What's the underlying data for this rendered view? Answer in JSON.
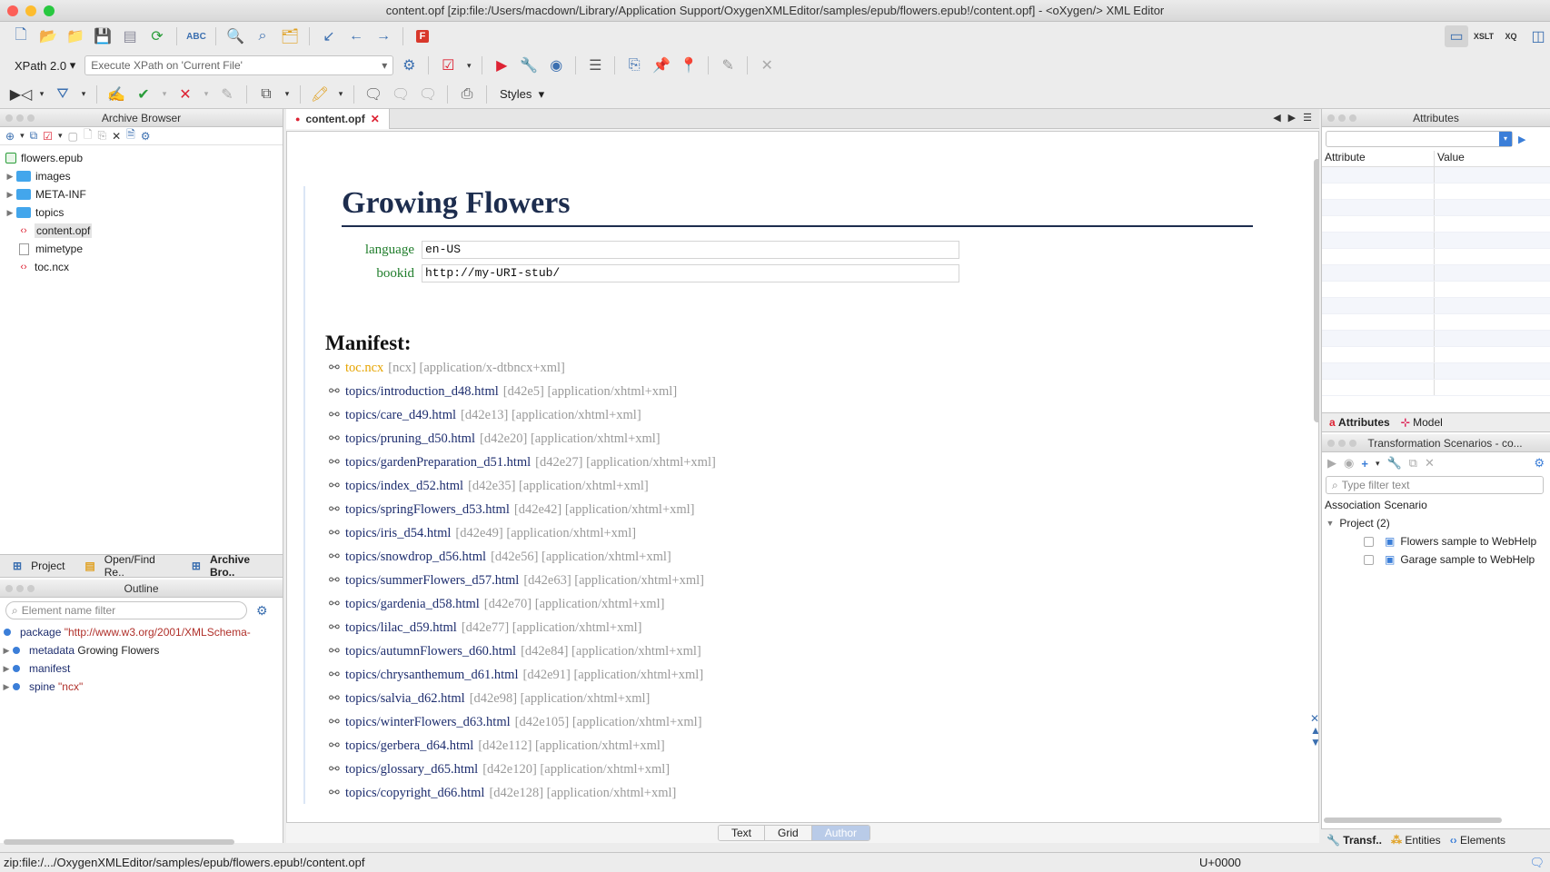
{
  "window": {
    "title": "content.opf [zip:file:/Users/macdown/Library/Application Support/OxygenXMLEditor/samples/epub/flowers.epub!/content.opf] - <oXygen/> XML Editor"
  },
  "xpath": {
    "version": "XPath 2.0",
    "placeholder": "Execute XPath on  'Current File'"
  },
  "toolbar": {
    "styles_label": "Styles"
  },
  "archive": {
    "title": "Archive Browser",
    "root": "flowers.epub",
    "items": [
      {
        "label": "images",
        "type": "folder"
      },
      {
        "label": "META-INF",
        "type": "folder"
      },
      {
        "label": "topics",
        "type": "folder"
      },
      {
        "label": "content.opf",
        "type": "xml"
      },
      {
        "label": "mimetype",
        "type": "file"
      },
      {
        "label": "toc.ncx",
        "type": "xml"
      }
    ]
  },
  "left_tabs": [
    "Project",
    "Open/Find Re..",
    "Archive Bro.."
  ],
  "outline": {
    "title": "Outline",
    "filter_placeholder": "Element name filter",
    "rows": [
      {
        "name": "package",
        "value": "\"http://www.w3.org/2001/XMLSchema-"
      },
      {
        "name": "metadata",
        "value": "Growing Flowers"
      },
      {
        "name": "manifest",
        "value": ""
      },
      {
        "name": "spine",
        "value": "\"ncx\""
      }
    ]
  },
  "editor": {
    "tab_label": "content.opf",
    "title": "Growing Flowers",
    "meta": [
      {
        "label": "language",
        "value": "en-US"
      },
      {
        "label": "bookid",
        "value": "http://my-URI-stub/"
      }
    ],
    "manifest_heading": "Manifest:",
    "manifest": [
      {
        "href": "toc.ncx",
        "info": "[ncx] [application/x-dtbncx+xml]"
      },
      {
        "href": "topics/introduction_d48.html",
        "info": "[d42e5] [application/xhtml+xml]"
      },
      {
        "href": "topics/care_d49.html",
        "info": "[d42e13] [application/xhtml+xml]"
      },
      {
        "href": "topics/pruning_d50.html",
        "info": "[d42e20] [application/xhtml+xml]"
      },
      {
        "href": "topics/gardenPreparation_d51.html",
        "info": "[d42e27] [application/xhtml+xml]"
      },
      {
        "href": "topics/index_d52.html",
        "info": "[d42e35] [application/xhtml+xml]"
      },
      {
        "href": "topics/springFlowers_d53.html",
        "info": "[d42e42] [application/xhtml+xml]"
      },
      {
        "href": "topics/iris_d54.html",
        "info": "[d42e49] [application/xhtml+xml]"
      },
      {
        "href": "topics/snowdrop_d56.html",
        "info": "[d42e56] [application/xhtml+xml]"
      },
      {
        "href": "topics/summerFlowers_d57.html",
        "info": "[d42e63] [application/xhtml+xml]"
      },
      {
        "href": "topics/gardenia_d58.html",
        "info": "[d42e70] [application/xhtml+xml]"
      },
      {
        "href": "topics/lilac_d59.html",
        "info": "[d42e77] [application/xhtml+xml]"
      },
      {
        "href": "topics/autumnFlowers_d60.html",
        "info": "[d42e84] [application/xhtml+xml]"
      },
      {
        "href": "topics/chrysanthemum_d61.html",
        "info": "[d42e91] [application/xhtml+xml]"
      },
      {
        "href": "topics/salvia_d62.html",
        "info": "[d42e98] [application/xhtml+xml]"
      },
      {
        "href": "topics/winterFlowers_d63.html",
        "info": "[d42e105] [application/xhtml+xml]"
      },
      {
        "href": "topics/gerbera_d64.html",
        "info": "[d42e112] [application/xhtml+xml]"
      },
      {
        "href": "topics/glossary_d65.html",
        "info": "[d42e120] [application/xhtml+xml]"
      },
      {
        "href": "topics/copyright_d66.html",
        "info": "[d42e128] [application/xhtml+xml]"
      }
    ],
    "modes": [
      "Text",
      "Grid",
      "Author"
    ],
    "active_mode": "Author"
  },
  "attributes": {
    "title": "Attributes",
    "col_attribute": "Attribute",
    "col_value": "Value",
    "tabs": [
      "Attributes",
      "Model"
    ]
  },
  "scenarios": {
    "title": "Transformation Scenarios - co...",
    "filter_placeholder": "Type filter text",
    "col_association": "Association",
    "col_scenario": "Scenario",
    "group": "Project (2)",
    "items": [
      "Flowers sample to WebHelp",
      "Garage sample to WebHelp"
    ]
  },
  "bottom_tabs": [
    "Transf..",
    "Entities",
    "Elements"
  ],
  "status": {
    "path": "zip:file:/.../OxygenXMLEditor/samples/epub/flowers.epub!/content.opf",
    "unicode": "U+0000"
  }
}
